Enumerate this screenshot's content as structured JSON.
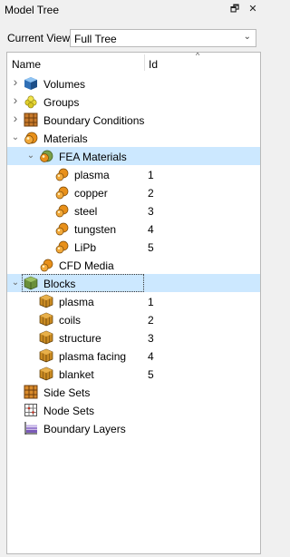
{
  "panel": {
    "title": "Model Tree",
    "float_glyph": "🗗",
    "close_glyph": "✕"
  },
  "view": {
    "label": "Current View",
    "value": "Full Tree"
  },
  "columns": {
    "name": "Name",
    "id": "Id"
  },
  "tree": [
    {
      "label": "Volumes",
      "id": "",
      "icon": "volume-cube-icon",
      "expander": "collapsed",
      "level": 0
    },
    {
      "label": "Groups",
      "id": "",
      "icon": "groups-icon",
      "expander": "collapsed",
      "level": 0
    },
    {
      "label": "Boundary Conditions",
      "id": "",
      "icon": "boundary-conditions-icon",
      "expander": "collapsed",
      "level": 0
    },
    {
      "label": "Materials",
      "id": "",
      "icon": "materials-icon",
      "expander": "expanded",
      "level": 0
    },
    {
      "label": "FEA Materials",
      "id": "",
      "icon": "fea-materials-icon",
      "expander": "expanded",
      "level": 1,
      "selected": true
    },
    {
      "label": "plasma",
      "id": "1",
      "icon": "material-icon",
      "expander": "none",
      "level": 2
    },
    {
      "label": "copper",
      "id": "2",
      "icon": "material-icon",
      "expander": "none",
      "level": 2
    },
    {
      "label": "steel",
      "id": "3",
      "icon": "material-icon",
      "expander": "none",
      "level": 2
    },
    {
      "label": "tungsten",
      "id": "4",
      "icon": "material-icon",
      "expander": "none",
      "level": 2
    },
    {
      "label": "LiPb",
      "id": "5",
      "icon": "material-icon",
      "expander": "none",
      "level": 2
    },
    {
      "label": "CFD Media",
      "id": "",
      "icon": "material-icon",
      "expander": "none",
      "level": 1
    },
    {
      "label": "Blocks",
      "id": "",
      "icon": "blocks-icon",
      "expander": "expanded",
      "level": 0,
      "selected": true,
      "focused": true
    },
    {
      "label": "plasma",
      "id": "1",
      "icon": "block-icon",
      "expander": "none",
      "level": 1
    },
    {
      "label": "coils",
      "id": "2",
      "icon": "block-icon",
      "expander": "none",
      "level": 1
    },
    {
      "label": "structure",
      "id": "3",
      "icon": "block-icon",
      "expander": "none",
      "level": 1
    },
    {
      "label": "plasma facing",
      "id": "4",
      "icon": "block-icon",
      "expander": "none",
      "level": 1
    },
    {
      "label": "blanket",
      "id": "5",
      "icon": "block-icon",
      "expander": "none",
      "level": 1
    },
    {
      "label": "Side Sets",
      "id": "",
      "icon": "side-sets-icon",
      "expander": "none",
      "level": 0
    },
    {
      "label": "Node Sets",
      "id": "",
      "icon": "node-sets-icon",
      "expander": "none",
      "level": 0
    },
    {
      "label": "Boundary Layers",
      "id": "",
      "icon": "boundary-layers-icon",
      "expander": "none",
      "level": 0
    }
  ],
  "colors": {
    "selection": "#cce8ff",
    "material_orange": "#e8901a",
    "block_brown": "#9b6a1c"
  }
}
